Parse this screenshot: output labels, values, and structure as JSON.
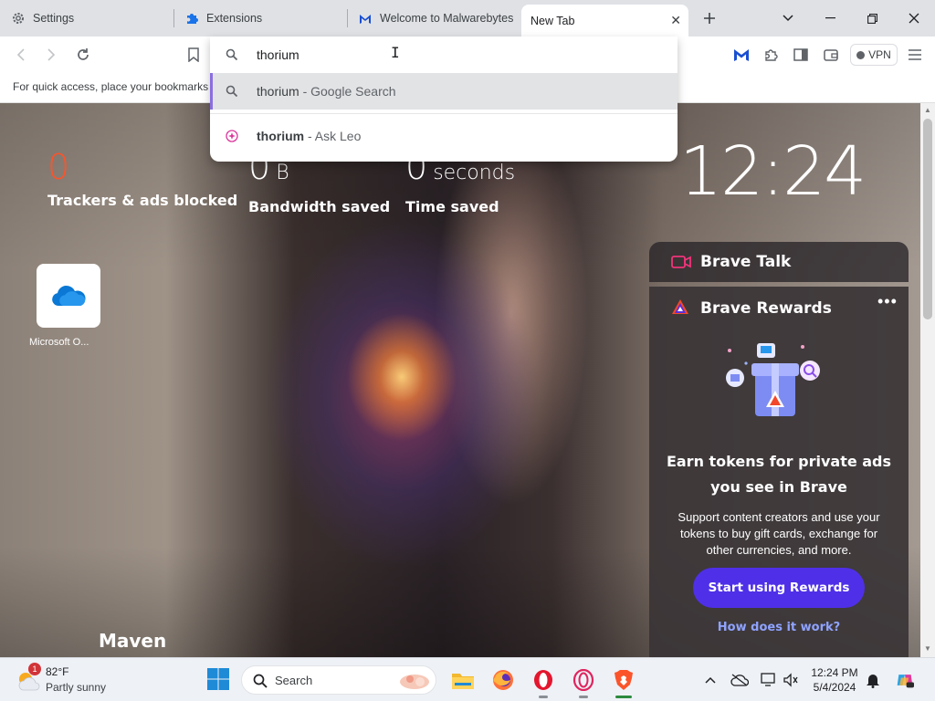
{
  "tabs": [
    {
      "label": "Settings",
      "icon": "gear-icon"
    },
    {
      "label": "Extensions",
      "icon": "puzzle-icon"
    },
    {
      "label": "Welcome to Malwarebytes",
      "icon": "malwarebytes-icon"
    },
    {
      "label": "New Tab",
      "icon": "none",
      "active": true
    }
  ],
  "toolbar": {
    "vpn_label": "VPN"
  },
  "bookmarks_bar": {
    "hint": "For quick access, place your bookmarks h"
  },
  "omnibox": {
    "value": "thorium",
    "suggestions": [
      {
        "match": "thorium",
        "sub": " - Google Search",
        "icon": "search-icon",
        "selected": true
      },
      {
        "match": "thorium",
        "sub": " - Ask Leo",
        "icon": "ask-leo-icon",
        "selected": false
      }
    ]
  },
  "ntp": {
    "stats": [
      {
        "value": "0",
        "unit": "",
        "label": "Trackers & ads blocked",
        "color": "#fb542b"
      },
      {
        "value": "0",
        "unit": "B",
        "label": "Bandwidth saved",
        "color": "#ffffff"
      },
      {
        "value": "0",
        "unit": "seconds",
        "label": "Time saved",
        "color": "#ffffff"
      }
    ],
    "clock": "12:24",
    "top_site": {
      "label": "Microsoft O...",
      "icon": "onedrive-icon"
    },
    "background_caption": "Maven"
  },
  "widgets": {
    "talk": {
      "title": "Brave Talk",
      "icon": "video-camera-icon"
    },
    "rewards": {
      "title": "Brave Rewards",
      "heading": "Earn tokens for private ads you see in Brave",
      "body": "Support content creators and use your tokens to buy gift cards, exchange for other currencies, and more.",
      "cta": "Start using Rewards",
      "link": "How does it work?",
      "accent": "#4f30e8"
    }
  },
  "taskbar": {
    "weather": {
      "temp": "82°F",
      "desc": "Partly sunny",
      "badge": "1"
    },
    "search_label": "Search",
    "time": "12:24 PM",
    "date": "5/4/2024",
    "apps": [
      "file-explorer-icon",
      "firefox-icon",
      "opera-icon",
      "opera-gx-icon",
      "brave-icon"
    ]
  }
}
